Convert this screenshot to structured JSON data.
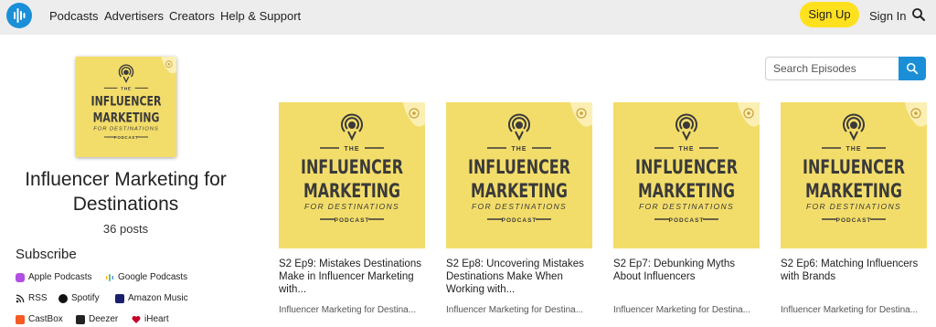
{
  "brand": {
    "accent": "#1a8fd8",
    "signup_color": "#ffe11f",
    "cover_bg": "#f3dd6a"
  },
  "nav": {
    "links": [
      "Podcasts",
      "Advertisers",
      "Creators",
      "Help & Support"
    ],
    "signup_label": "Sign Up",
    "signin_label": "Sign In"
  },
  "cover": {
    "line_the": "THE",
    "line_1": "INFLUENCER",
    "line_2": "MARKETING",
    "line_3": "FOR DESTINATIONS",
    "line_4": "PODCAST"
  },
  "podcast": {
    "title": "Influencer Marketing for Destinations",
    "posts": "36 posts"
  },
  "subscribe": {
    "heading": "Subscribe",
    "items": [
      {
        "label": "Apple Podcasts",
        "icon": "apple-podcasts-icon",
        "color": "#b150e2"
      },
      {
        "label": "Google Podcasts",
        "icon": "google-podcasts-icon",
        "color": "#f4b400"
      },
      {
        "label": "RSS",
        "icon": "rss-icon",
        "color": "#222222"
      },
      {
        "label": "Spotify",
        "icon": "spotify-icon",
        "color": "#111111"
      },
      {
        "label": "Amazon Music",
        "icon": "amazon-music-icon",
        "color": "#25d1da"
      },
      {
        "label": "CastBox",
        "icon": "castbox-icon",
        "color": "#f55b23"
      },
      {
        "label": "Deezer",
        "icon": "deezer-icon",
        "color": "#222222"
      },
      {
        "label": "iHeart",
        "icon": "iheart-icon",
        "color": "#c6002b"
      }
    ]
  },
  "search": {
    "placeholder": "Search Episodes"
  },
  "episodes": [
    {
      "title": "S2 Ep9: Mistakes Destinations Make in Influencer Marketing with...",
      "show": "Influencer Marketing for Destina..."
    },
    {
      "title": "S2 Ep8: Uncovering Mistakes Destinations Make When Working with...",
      "show": "Influencer Marketing for Destina..."
    },
    {
      "title": "S2 Ep7: Debunking Myths About Influencers",
      "show": "Influencer Marketing for Destina..."
    },
    {
      "title": "S2 Ep6: Matching Influencers with Brands",
      "show": "Influencer Marketing for Destina..."
    }
  ]
}
